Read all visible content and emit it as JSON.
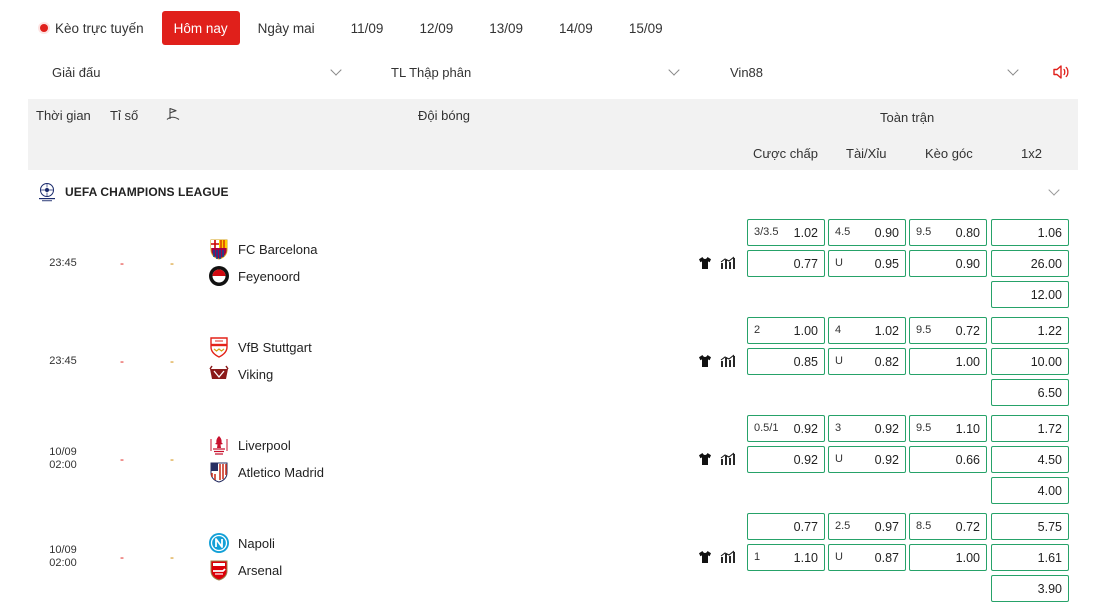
{
  "tabs": {
    "live_label": "Kèo trực tuyến",
    "items": [
      "Hôm nay",
      "Ngày mai",
      "11/09",
      "12/09",
      "13/09",
      "14/09",
      "15/09"
    ],
    "active_index": 0
  },
  "filters": {
    "league": "Giải đấu",
    "odds_format": "TL Thập phân",
    "bookmaker": "Vin88"
  },
  "table_header": {
    "time": "Thời gian",
    "score": "Tỉ số",
    "team": "Đội bóng",
    "full_match": "Toàn trận",
    "handicap": "Cược chấp",
    "over_under": "Tài/Xỉu",
    "corner": "Kèo góc",
    "one_x_two": "1x2"
  },
  "league": {
    "name": "UEFA CHAMPIONS LEAGUE"
  },
  "matches": [
    {
      "date": "",
      "time": "23:45",
      "score": "-",
      "ht": "-",
      "home": "FC Barcelona",
      "away": "Feyenoord",
      "handicap": [
        {
          "l": "3/3.5",
          "r": "1.02"
        },
        {
          "l": "",
          "r": "0.77"
        }
      ],
      "over_under": [
        {
          "l": "4.5",
          "r": "0.90"
        },
        {
          "l": "U",
          "r": "0.95"
        }
      ],
      "corner": [
        {
          "l": "9.5",
          "r": "0.80"
        },
        {
          "l": "",
          "r": "0.90"
        }
      ],
      "one_x_two": [
        "1.06",
        "26.00",
        "12.00"
      ]
    },
    {
      "date": "",
      "time": "23:45",
      "score": "-",
      "ht": "-",
      "home": "VfB Stuttgart",
      "away": "Viking",
      "handicap": [
        {
          "l": "2",
          "r": "1.00"
        },
        {
          "l": "",
          "r": "0.85"
        }
      ],
      "over_under": [
        {
          "l": "4",
          "r": "1.02"
        },
        {
          "l": "U",
          "r": "0.82"
        }
      ],
      "corner": [
        {
          "l": "9.5",
          "r": "0.72"
        },
        {
          "l": "",
          "r": "1.00"
        }
      ],
      "one_x_two": [
        "1.22",
        "10.00",
        "6.50"
      ]
    },
    {
      "date": "10/09",
      "time": "02:00",
      "score": "-",
      "ht": "-",
      "home": "Liverpool",
      "away": "Atletico Madrid",
      "handicap": [
        {
          "l": "0.5/1",
          "r": "0.92"
        },
        {
          "l": "",
          "r": "0.92"
        }
      ],
      "over_under": [
        {
          "l": "3",
          "r": "0.92"
        },
        {
          "l": "U",
          "r": "0.92"
        }
      ],
      "corner": [
        {
          "l": "9.5",
          "r": "1.10"
        },
        {
          "l": "",
          "r": "0.66"
        }
      ],
      "one_x_two": [
        "1.72",
        "4.50",
        "4.00"
      ]
    },
    {
      "date": "10/09",
      "time": "02:00",
      "score": "-",
      "ht": "-",
      "home": "Napoli",
      "away": "Arsenal",
      "handicap": [
        {
          "l": "",
          "r": "0.77"
        },
        {
          "l": "1",
          "r": "1.10"
        }
      ],
      "over_under": [
        {
          "l": "2.5",
          "r": "0.97"
        },
        {
          "l": "U",
          "r": "0.87"
        }
      ],
      "corner": [
        {
          "l": "8.5",
          "r": "0.72"
        },
        {
          "l": "",
          "r": "1.00"
        }
      ],
      "one_x_two": [
        "5.75",
        "1.61",
        "3.90"
      ]
    }
  ],
  "colors": {
    "accent": "#e0201b",
    "odds_border": "#26a269",
    "header_bg": "#f2f2f2"
  }
}
